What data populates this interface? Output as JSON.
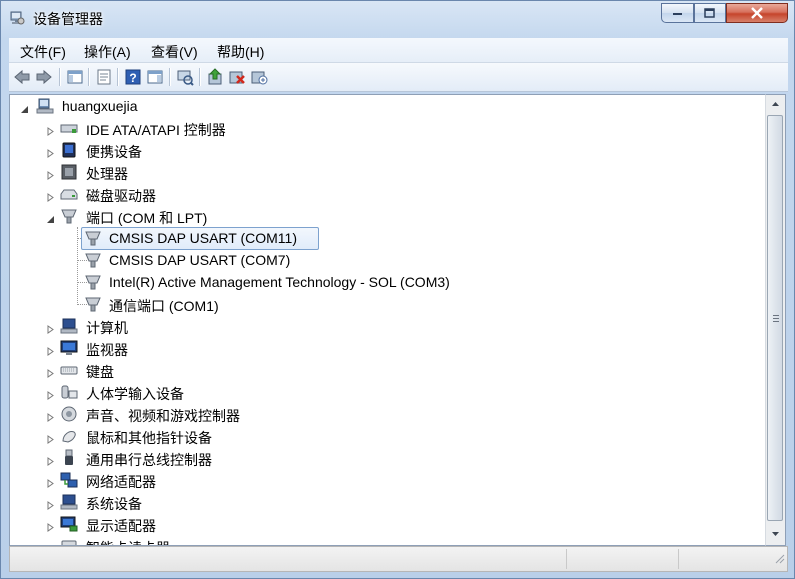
{
  "window": {
    "title": "设备管理器"
  },
  "menu": [
    {
      "label": "文件(F)"
    },
    {
      "label": "操作(A)"
    },
    {
      "label": "查看(V)"
    },
    {
      "label": "帮助(H)"
    }
  ],
  "toolbar": {
    "buttons": [
      "back-arrow-icon",
      "forward-arrow-icon",
      "show-hide-console-tree-icon",
      "properties-icon",
      "help-icon",
      "action-pane-icon",
      "scan-hardware-icon",
      "update-driver-icon",
      "uninstall-icon",
      "enable-device-icon"
    ]
  },
  "tree": {
    "root": "huangxuejia",
    "categories": [
      {
        "label": "IDE ATA/ATAPI 控制器",
        "icon": "ide-controller-icon"
      },
      {
        "label": "便携设备",
        "icon": "portable-device-icon"
      },
      {
        "label": "处理器",
        "icon": "processor-icon"
      },
      {
        "label": "磁盘驱动器",
        "icon": "disk-drive-icon"
      },
      {
        "label": "端口 (COM 和 LPT)",
        "icon": "port-icon",
        "expanded": true,
        "children": [
          {
            "label": "CMSIS DAP USART (COM11)",
            "selected": true
          },
          {
            "label": "CMSIS DAP USART (COM7)"
          },
          {
            "label": "Intel(R) Active Management Technology - SOL (COM3)"
          },
          {
            "label": "通信端口 (COM1)"
          }
        ]
      },
      {
        "label": "计算机",
        "icon": "computer-icon"
      },
      {
        "label": "监视器",
        "icon": "monitor-icon"
      },
      {
        "label": "键盘",
        "icon": "keyboard-icon"
      },
      {
        "label": "人体学输入设备",
        "icon": "hid-icon"
      },
      {
        "label": "声音、视频和游戏控制器",
        "icon": "sound-icon"
      },
      {
        "label": "鼠标和其他指针设备",
        "icon": "mouse-icon"
      },
      {
        "label": "通用串行总线控制器",
        "icon": "usb-icon"
      },
      {
        "label": "网络适配器",
        "icon": "network-icon"
      },
      {
        "label": "系统设备",
        "icon": "system-device-icon"
      },
      {
        "label": "显示适配器",
        "icon": "display-adapter-icon"
      },
      {
        "label": "智能卡读卡器",
        "icon": "smartcard-icon"
      }
    ]
  }
}
